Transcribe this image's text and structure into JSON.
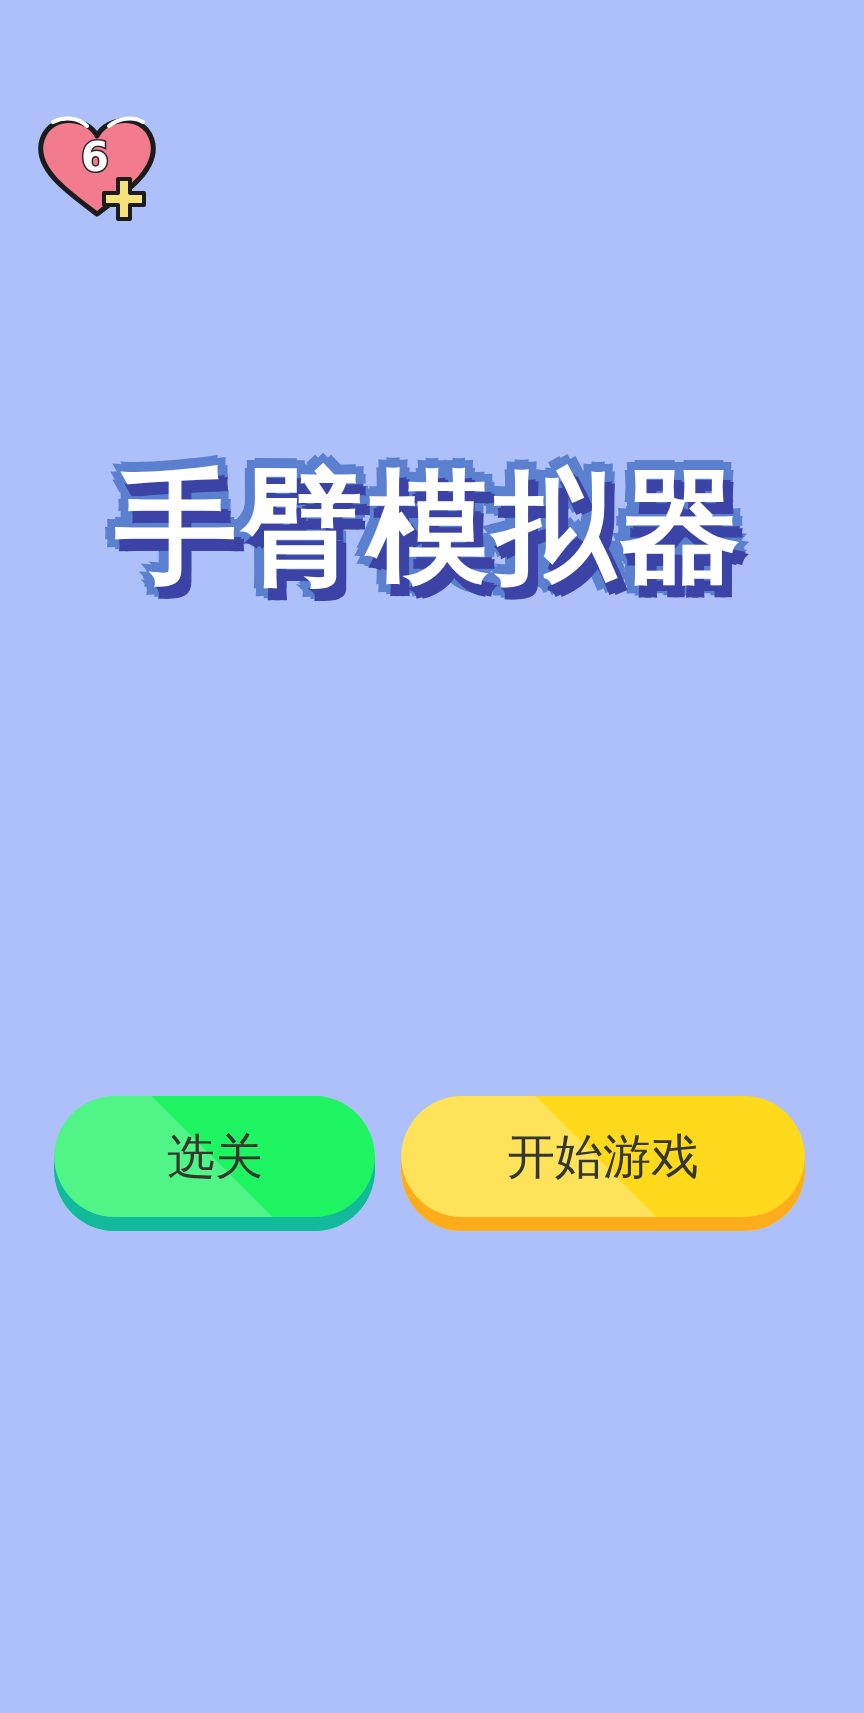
{
  "lives": {
    "count": "6"
  },
  "title": "手臂模拟器",
  "buttons": [
    {
      "label": "选关",
      "kind": "secondary"
    },
    {
      "label": "开始游戏",
      "kind": "primary"
    }
  ]
}
